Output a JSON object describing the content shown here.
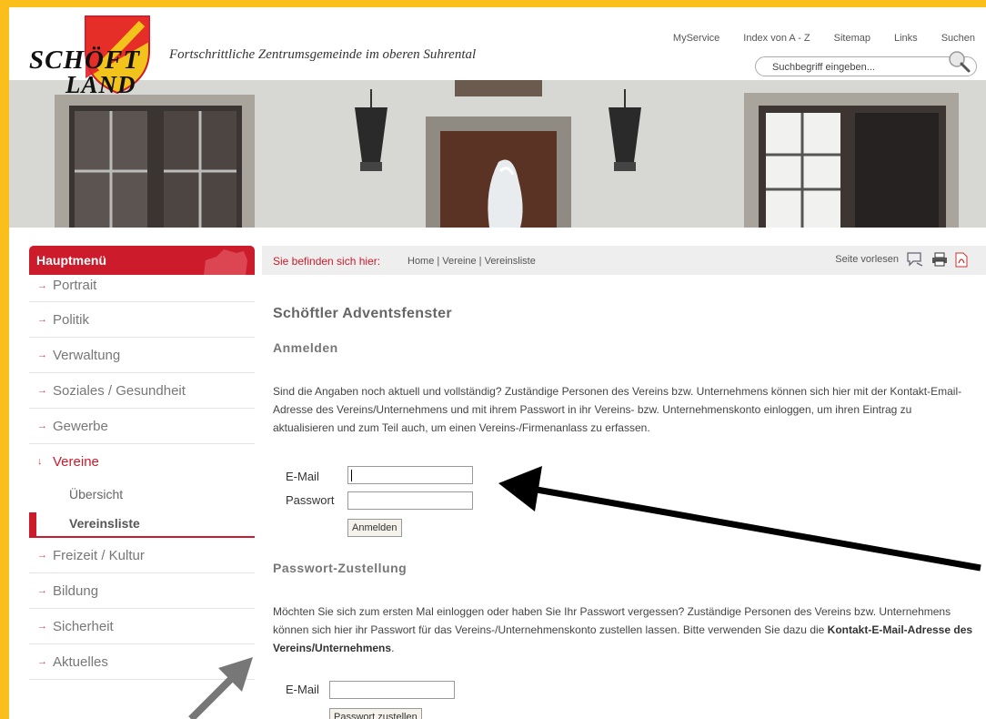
{
  "header": {
    "logo_line1": "SCHÖFT",
    "logo_line2": "LAND",
    "tagline": "Fortschrittliche Zentrumsgemeinde im oberen Suhrental",
    "topnav": [
      "MyService",
      "Index von A - Z",
      "Sitemap",
      "Links",
      "Suchen"
    ],
    "search_placeholder": "Suchbegriff eingeben..."
  },
  "sidebar": {
    "title": "Hauptmenü",
    "items": [
      {
        "label": "Portrait"
      },
      {
        "label": "Politik"
      },
      {
        "label": "Verwaltung"
      },
      {
        "label": "Soziales / Gesundheit"
      },
      {
        "label": "Gewerbe"
      },
      {
        "label": "Vereine",
        "expanded": true
      },
      {
        "label": "Freizeit / Kultur"
      },
      {
        "label": "Bildung"
      },
      {
        "label": "Sicherheit"
      },
      {
        "label": "Aktuelles"
      }
    ],
    "sub_items": [
      {
        "label": "Übersicht"
      },
      {
        "label": "Vereinsliste",
        "current": true
      }
    ]
  },
  "breadcrumb": {
    "label": "Sie befinden sich hier:",
    "path": "Home | Vereine | Vereinsliste",
    "read_aloud": "Seite vorlesen"
  },
  "content": {
    "heading": "Schöftler Adventsfenster",
    "login_heading": "Anmelden",
    "login_text": "Sind die Angaben noch aktuell und vollständig? Zuständige Personen des Vereins bzw. Unternehmens können sich hier mit der Kontakt-Email-Adresse des Vereins/Unternehmens und mit ihrem Passwort in ihr Vereins- bzw. Unternehmenskonto einloggen, um ihren Eintrag zu aktualisieren und zum Teil auch, um einen Vereins-/Firmenanlass zu erfassen.",
    "email_label": "E-Mail",
    "password_label": "Passwort",
    "login_button": "Anmelden",
    "reset_heading": "Passwort-Zustellung",
    "reset_text": "Möchten Sie sich zum ersten Mal einloggen oder haben Sie Ihr Passwort vergessen? Zuständige Personen des Vereins bzw. Unternehmens können sich hier ihr Passwort für das Vereins-/Unternehmenskonto zustellen lassen. Bitte verwenden Sie dazu die",
    "reset_text_bold": "Kontakt-E-Mail-Adresse des Vereins/Unternehmens",
    "reset_text_end": ".",
    "reset_email_label": "E-Mail",
    "reset_button": "Passwort zustellen"
  },
  "colors": {
    "accent": "#cc1b2b",
    "frame": "#fbbf1c"
  }
}
